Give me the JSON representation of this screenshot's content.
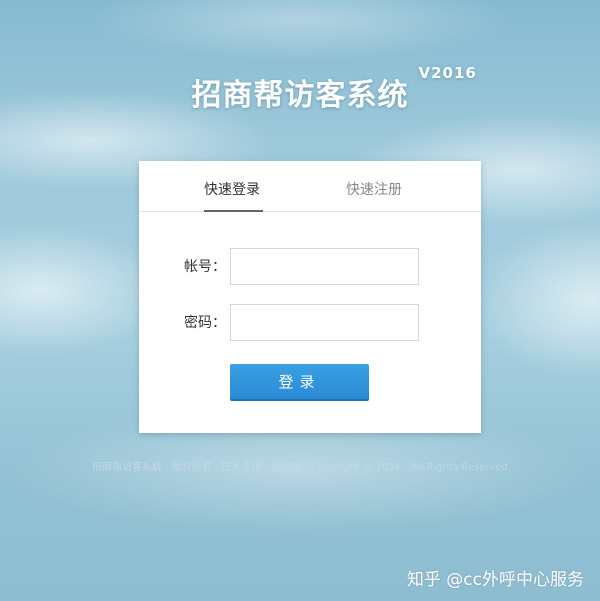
{
  "header": {
    "title": "招商帮访客系统",
    "version": "V2016"
  },
  "tabs": [
    {
      "label": "快速登录",
      "active": true
    },
    {
      "label": "快速注册",
      "active": false
    }
  ],
  "form": {
    "account_label": "帐号：",
    "account_value": "",
    "password_label": "密码：",
    "password_value": "",
    "login_button": "登录"
  },
  "footer": {
    "text": "招商帮访客系统  ·  版权所有  ·  技术支持：招商帮  ·  Copyright © 2016  ·  All Rights Reserved"
  },
  "watermark": {
    "text": "知乎 @cc外呼中心服务"
  },
  "colors": {
    "accent": "#2a8bd6",
    "sky": "#9ec9db"
  }
}
